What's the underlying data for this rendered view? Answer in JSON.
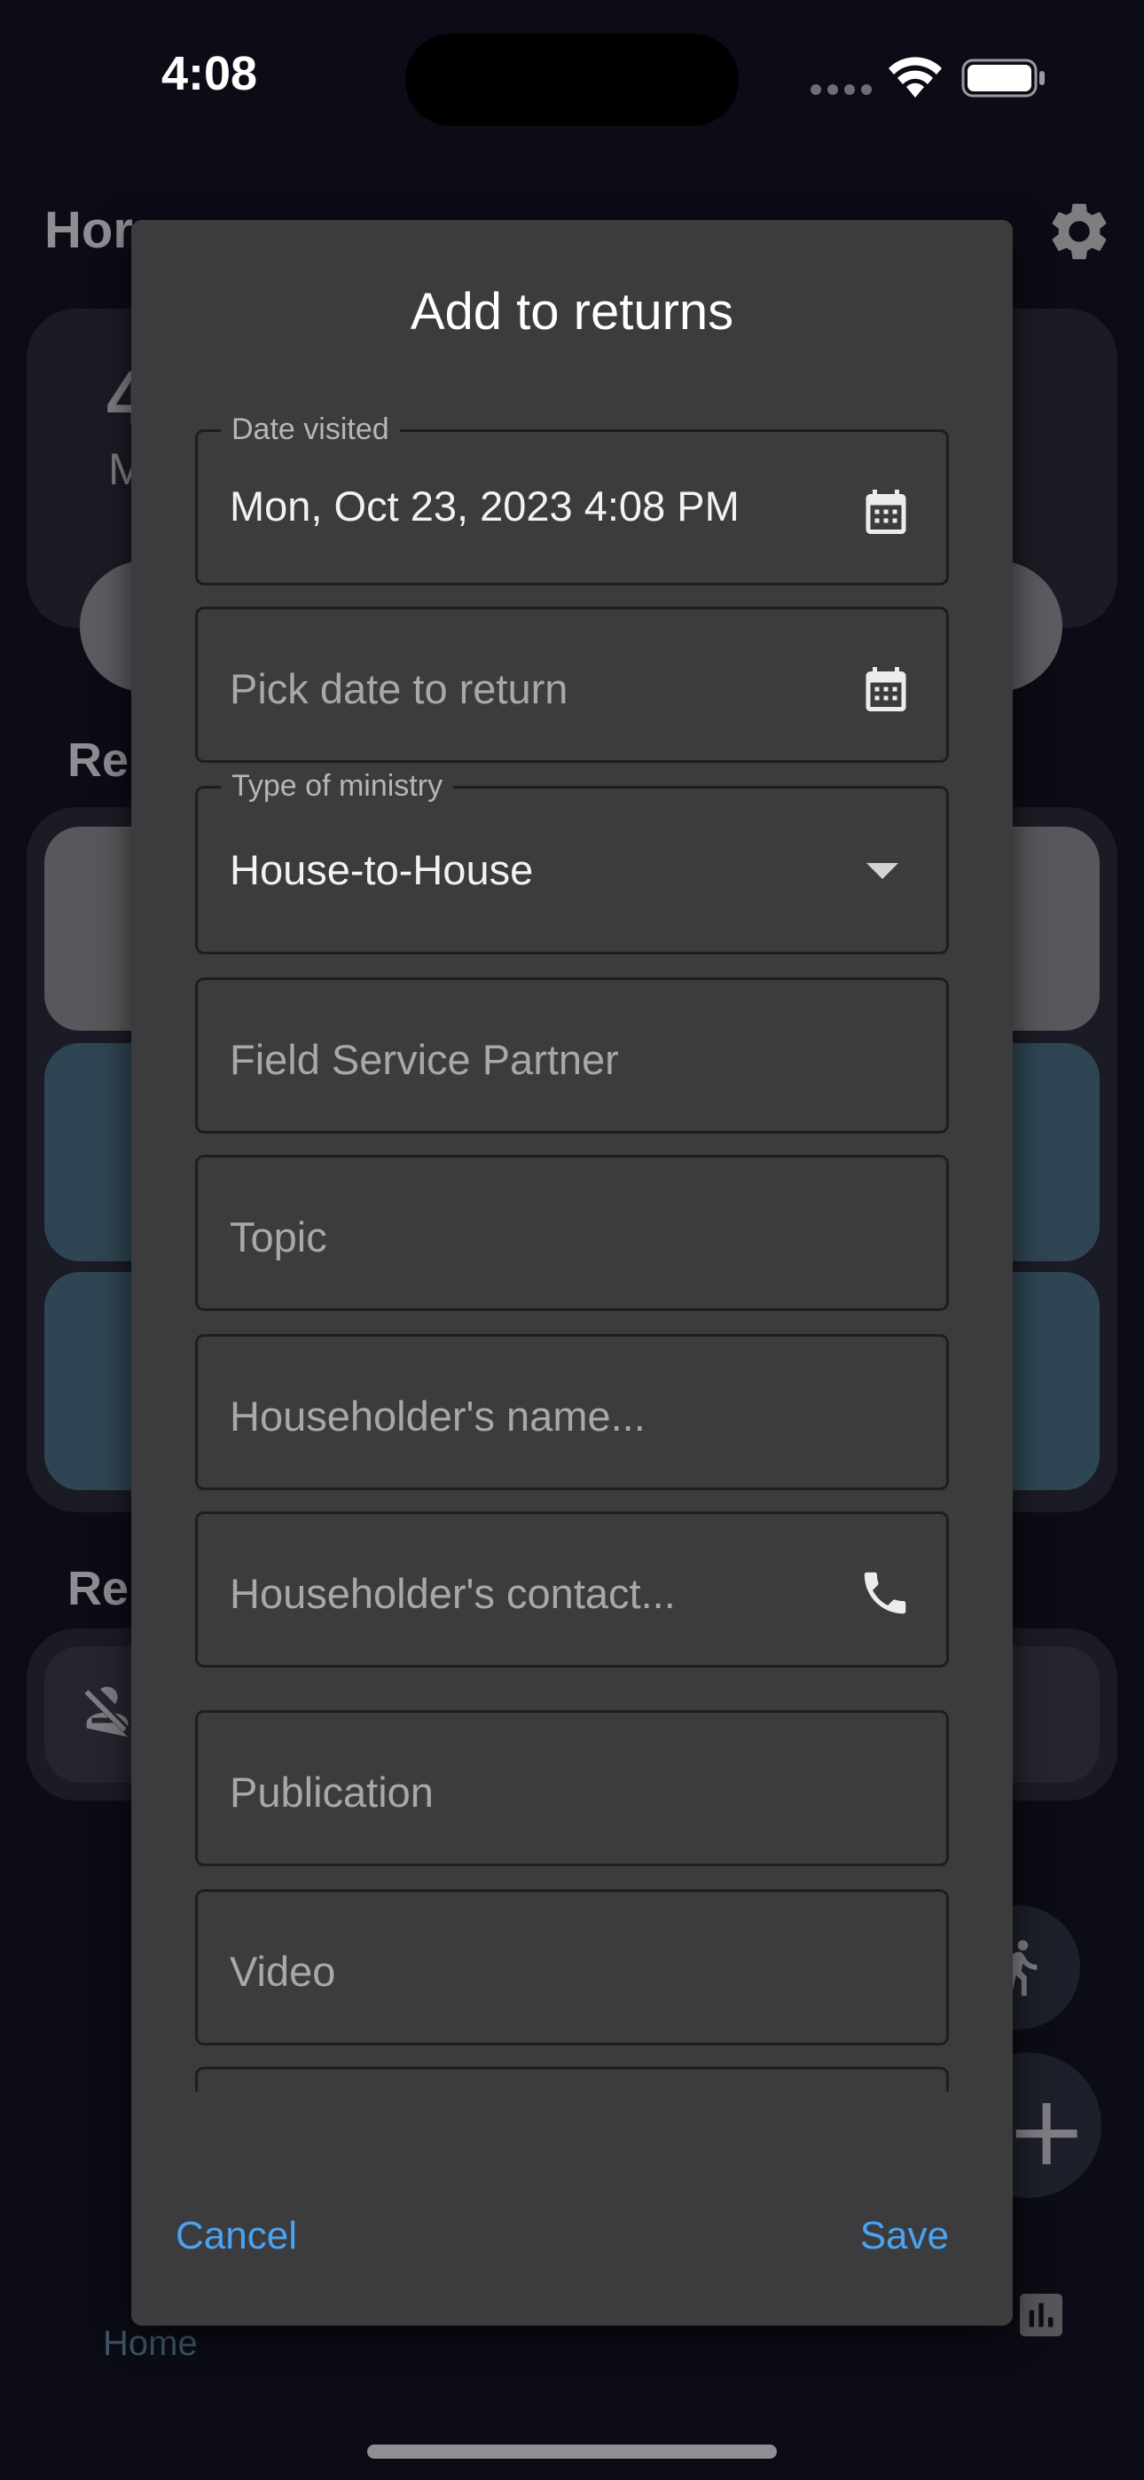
{
  "status_bar": {
    "time": "4:08"
  },
  "background": {
    "screen_title": "Hor",
    "big_digit": "4",
    "small_text": "M",
    "section_1_title": "Re",
    "section_2_title": "Re",
    "nav_home_label": "Home",
    "fab_add_glyph": "+"
  },
  "dialog": {
    "title": "Add to returns",
    "date_visited": {
      "label": "Date visited",
      "value": "Mon, Oct 23, 2023 4:08 PM",
      "icon": "calendar-icon"
    },
    "return_date": {
      "placeholder": "Pick date to return",
      "icon": "calendar-icon"
    },
    "ministry_type": {
      "label": "Type of ministry",
      "value": "House-to-House",
      "icon": "dropdown-arrow-icon"
    },
    "partner": {
      "placeholder": "Field Service Partner"
    },
    "topic": {
      "placeholder": "Topic"
    },
    "householder_name": {
      "placeholder": "Householder's name..."
    },
    "householder_contact": {
      "placeholder": "Householder's contact...",
      "icon": "phone-icon"
    },
    "publication": {
      "placeholder": "Publication"
    },
    "video": {
      "placeholder": "Video"
    },
    "cancel_label": "Cancel",
    "save_label": "Save"
  },
  "colors": {
    "accent": "#4aa3f0",
    "dialog_bg": "#3c3c3e",
    "screen_bg": "#0b0c16",
    "list_item_blue": "#2f4553"
  }
}
